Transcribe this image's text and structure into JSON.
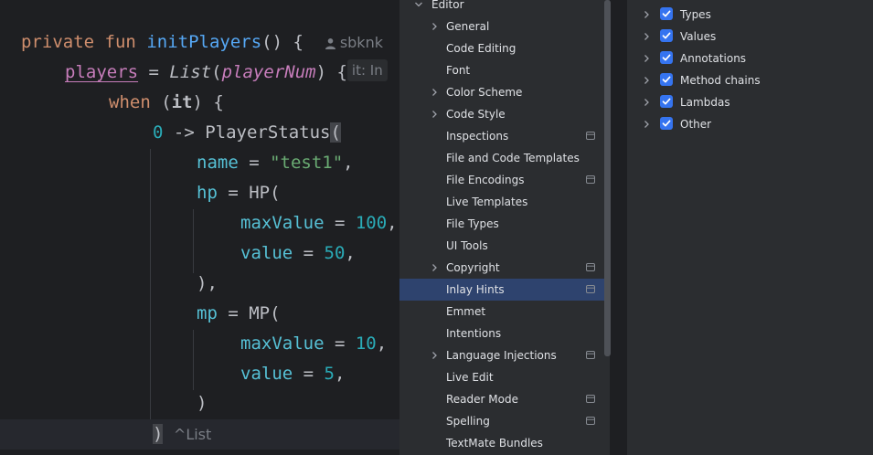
{
  "editor": {
    "line1": {
      "kw_private": "private",
      "kw_fun": "fun",
      "fn_name": "initPlayers",
      "parens": "() {",
      "author_hint": "sbknk"
    },
    "line2": {
      "players": "players",
      "eq": " = ",
      "list_type": "List",
      "open": "(",
      "player_num": "playerNum",
      "close": ") {",
      "it_hint": "it: In"
    },
    "line3": {
      "kw_when": "when",
      "open": " (",
      "it": "it",
      "close": ") {"
    },
    "line4": {
      "zero": "0",
      "arrow": " -> PlayerStatus",
      "paren": "("
    },
    "line5": {
      "name": "name",
      "eq": " = ",
      "value": "\"test1\"",
      "comma": ","
    },
    "line6": {
      "hp": "hp",
      "eq": " = ",
      "ctor": "HP("
    },
    "line7": {
      "maxValue": "maxValue",
      "eq": " = ",
      "value": "100",
      "comma": ","
    },
    "line8": {
      "value_name": "value",
      "eq": " = ",
      "value": "50",
      "comma": ","
    },
    "line9": {
      "text": "),"
    },
    "line10": {
      "mp": "mp",
      "eq": " = ",
      "ctor": "MP("
    },
    "line11": {
      "maxValue": "maxValue",
      "eq": " = ",
      "value": "10",
      "comma": ","
    },
    "line12": {
      "value_name": "value",
      "eq": " = ",
      "value": "5",
      "comma": ","
    },
    "line13": {
      "text": ")"
    },
    "line14": {
      "paren": ")",
      "type_hint": "^List"
    }
  },
  "settings_tree": {
    "root": "Editor",
    "items": [
      {
        "label": "General",
        "expandable": true,
        "badge": false
      },
      {
        "label": "Code Editing",
        "expandable": false,
        "badge": false
      },
      {
        "label": "Font",
        "expandable": false,
        "badge": false
      },
      {
        "label": "Color Scheme",
        "expandable": true,
        "badge": false
      },
      {
        "label": "Code Style",
        "expandable": true,
        "badge": false
      },
      {
        "label": "Inspections",
        "expandable": false,
        "badge": true
      },
      {
        "label": "File and Code Templates",
        "expandable": false,
        "badge": false
      },
      {
        "label": "File Encodings",
        "expandable": false,
        "badge": true
      },
      {
        "label": "Live Templates",
        "expandable": false,
        "badge": false
      },
      {
        "label": "File Types",
        "expandable": false,
        "badge": false
      },
      {
        "label": "UI Tools",
        "expandable": false,
        "badge": false
      },
      {
        "label": "Copyright",
        "expandable": true,
        "badge": true
      },
      {
        "label": "Inlay Hints",
        "expandable": false,
        "badge": true,
        "selected": true
      },
      {
        "label": "Emmet",
        "expandable": false,
        "badge": false
      },
      {
        "label": "Intentions",
        "expandable": false,
        "badge": false
      },
      {
        "label": "Language Injections",
        "expandable": true,
        "badge": true
      },
      {
        "label": "Live Edit",
        "expandable": false,
        "badge": false
      },
      {
        "label": "Reader Mode",
        "expandable": false,
        "badge": true
      },
      {
        "label": "Spelling",
        "expandable": false,
        "badge": true
      },
      {
        "label": "TextMate Bundles",
        "expandable": false,
        "badge": false
      }
    ]
  },
  "inlay_options": [
    {
      "label": "Types",
      "checked": true
    },
    {
      "label": "Values",
      "checked": true
    },
    {
      "label": "Annotations",
      "checked": true
    },
    {
      "label": "Method chains",
      "checked": true
    },
    {
      "label": "Lambdas",
      "checked": true
    },
    {
      "label": "Other",
      "checked": true
    }
  ],
  "colors": {
    "editor_bg": "#1e1f22",
    "panel_bg": "#2b2d30",
    "selection": "#2e436e",
    "checkbox": "#3574f0",
    "keyword": "#cf8e6d",
    "function": "#56a8f5",
    "property": "#c77dbb",
    "number": "#2aacb8",
    "string": "#6aab73"
  }
}
